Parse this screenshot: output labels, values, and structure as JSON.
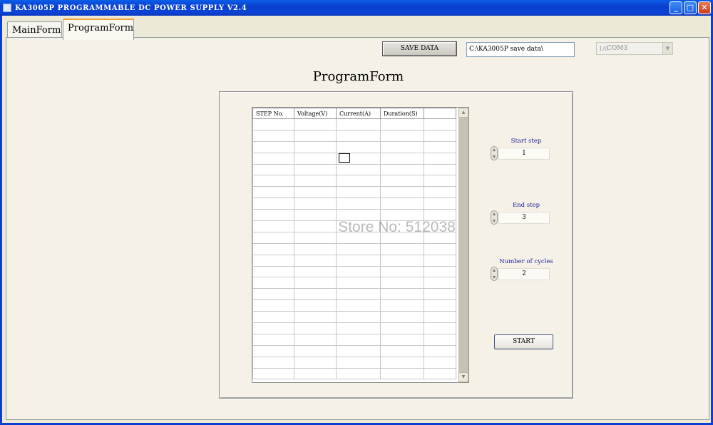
{
  "window": {
    "title": "KA3005P PROGRAMMABLE DC POWER SUPPLY V2.4",
    "controls": {
      "minimize": "_",
      "maximize": "□",
      "close": "✕"
    }
  },
  "tabs": [
    {
      "label": "MainForm",
      "selected": false
    },
    {
      "label": "ProgramForm",
      "selected": true
    }
  ],
  "toolbar": {
    "save_label": "SAVE DATA",
    "save_path": "C:\\KA3005P save data\\",
    "com_port": "COM3",
    "com_indicator": "1/0",
    "com_arrow": "▼"
  },
  "form": {
    "title": "ProgramForm"
  },
  "table": {
    "columns": [
      "STEP No.",
      "Voltage(V)",
      "Current(A)",
      "Duration(S)",
      ""
    ],
    "row_count": 23,
    "scroll_up": "▲",
    "scroll_down": "▼"
  },
  "controls": {
    "start_step": {
      "label": "Start  step",
      "value": "1"
    },
    "end_step": {
      "label": "End  step",
      "value": "3"
    },
    "cycles": {
      "label": "Number of  cycles",
      "value": "2"
    },
    "start_button": "START"
  },
  "watermark": "Store No: 512038",
  "colors": {
    "titlebar": "#0a3fcf",
    "panel_bg": "#f5f1e6",
    "label_blue": "#1a1aa0"
  }
}
